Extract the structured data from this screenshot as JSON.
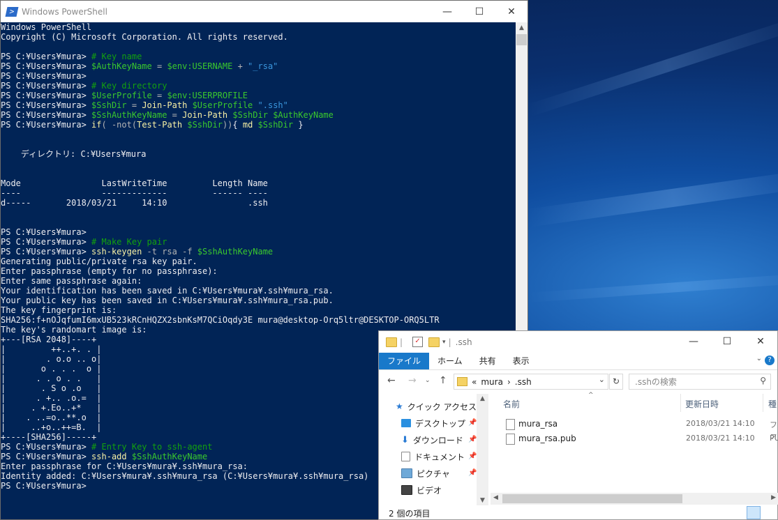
{
  "powershell": {
    "title": "Windows PowerShell",
    "lines": [
      [
        [
          "Windows PowerShell",
          "w"
        ]
      ],
      [
        [
          "Copyright (C) Microsoft Corporation. All rights reserved.",
          "w"
        ]
      ],
      [
        [
          "",
          "w"
        ]
      ],
      [
        [
          "PS C:¥Users¥mura> ",
          "w"
        ],
        [
          "# Key name",
          "cmt"
        ]
      ],
      [
        [
          "PS C:¥Users¥mura> ",
          "w"
        ],
        [
          "$AuthKeyName",
          "var"
        ],
        [
          " = ",
          "op"
        ],
        [
          "$env:USERNAME",
          "var"
        ],
        [
          " + ",
          "op"
        ],
        [
          "\"_rsa\"",
          "str"
        ]
      ],
      [
        [
          "PS C:¥Users¥mura>",
          "w"
        ]
      ],
      [
        [
          "PS C:¥Users¥mura> ",
          "w"
        ],
        [
          "# Key directory",
          "cmt"
        ]
      ],
      [
        [
          "PS C:¥Users¥mura> ",
          "w"
        ],
        [
          "$UserProfile",
          "var"
        ],
        [
          " = ",
          "op"
        ],
        [
          "$env:USERPROFILE",
          "var"
        ]
      ],
      [
        [
          "PS C:¥Users¥mura> ",
          "w"
        ],
        [
          "$SshDir",
          "var"
        ],
        [
          " = ",
          "op"
        ],
        [
          "Join-Path",
          "cmd"
        ],
        [
          " ",
          "w"
        ],
        [
          "$UserProfile",
          "var"
        ],
        [
          " ",
          "w"
        ],
        [
          "\".ssh\"",
          "str"
        ]
      ],
      [
        [
          "PS C:¥Users¥mura> ",
          "w"
        ],
        [
          "$SshAuthKeyName",
          "var"
        ],
        [
          " = ",
          "op"
        ],
        [
          "Join-Path",
          "cmd"
        ],
        [
          " ",
          "w"
        ],
        [
          "$SshDir",
          "var"
        ],
        [
          " ",
          "w"
        ],
        [
          "$AuthKeyName",
          "var"
        ]
      ],
      [
        [
          "PS C:¥Users¥mura> ",
          "w"
        ],
        [
          "if",
          "cmd"
        ],
        [
          "( ",
          "par"
        ],
        [
          "-not",
          "par"
        ],
        [
          "(",
          "par"
        ],
        [
          "Test-Path",
          "cmd"
        ],
        [
          " ",
          "w"
        ],
        [
          "$SshDir",
          "var"
        ],
        [
          "))",
          "par"
        ],
        [
          "{ ",
          "w"
        ],
        [
          "md",
          "cmd"
        ],
        [
          " ",
          "w"
        ],
        [
          "$SshDir",
          "var"
        ],
        [
          " }",
          "w"
        ]
      ],
      [
        [
          "",
          "w"
        ]
      ],
      [
        [
          "",
          "w"
        ]
      ],
      [
        [
          "    ディレクトリ: C:¥Users¥mura",
          "w"
        ]
      ],
      [
        [
          "",
          "w"
        ]
      ],
      [
        [
          "",
          "w"
        ]
      ],
      [
        [
          "Mode                LastWriteTime         Length Name",
          "w"
        ]
      ],
      [
        [
          "----                -------------         ------ ----",
          "w"
        ]
      ],
      [
        [
          "d-----       2018/03/21     14:10                .ssh",
          "w"
        ]
      ],
      [
        [
          "",
          "w"
        ]
      ],
      [
        [
          "",
          "w"
        ]
      ],
      [
        [
          "PS C:¥Users¥mura>",
          "w"
        ]
      ],
      [
        [
          "PS C:¥Users¥mura> ",
          "w"
        ],
        [
          "# Make Key pair",
          "cmt"
        ]
      ],
      [
        [
          "PS C:¥Users¥mura> ",
          "w"
        ],
        [
          "ssh-keygen",
          "cmd"
        ],
        [
          " -t rsa -f ",
          "par"
        ],
        [
          "$SshAuthKeyName",
          "var"
        ]
      ],
      [
        [
          "Generating public/private rsa key pair.",
          "w"
        ]
      ],
      [
        [
          "Enter passphrase (empty for no passphrase):",
          "w"
        ]
      ],
      [
        [
          "Enter same passphrase again:",
          "w"
        ]
      ],
      [
        [
          "Your identification has been saved in C:¥Users¥mura¥.ssh¥mura_rsa.",
          "w"
        ]
      ],
      [
        [
          "Your public key has been saved in C:¥Users¥mura¥.ssh¥mura_rsa.pub.",
          "w"
        ]
      ],
      [
        [
          "The key fingerprint is:",
          "w"
        ]
      ],
      [
        [
          "SHA256:f+nOJqfumI6mxUB523kRCnHQZX2sbnKsM7QCiOqdy3E mura@desktop-Orq5ltr@DESKTOP-ORQ5LTR",
          "w"
        ]
      ],
      [
        [
          "The key's randomart image is:",
          "w"
        ]
      ],
      [
        [
          "+---[RSA 2048]----+",
          "w"
        ]
      ],
      [
        [
          "|         ++..+. . |",
          "w"
        ]
      ],
      [
        [
          "|        . o.o .. o|",
          "w"
        ]
      ],
      [
        [
          "|       o . . .  o |",
          "w"
        ]
      ],
      [
        [
          "|      . . o . .   |",
          "w"
        ]
      ],
      [
        [
          "|       . S o .o   |",
          "w"
        ]
      ],
      [
        [
          "|      . +.. .o.=  |",
          "w"
        ]
      ],
      [
        [
          "|     . +.Eo..+*   |",
          "w"
        ]
      ],
      [
        [
          "|    . ..=o..**.o  |",
          "w"
        ]
      ],
      [
        [
          "|     ..+o..++=B.  |",
          "w"
        ]
      ],
      [
        [
          "+----[SHA256]-----+",
          "w"
        ]
      ],
      [
        [
          "PS C:¥Users¥mura> ",
          "w"
        ],
        [
          "# Entry Key to ssh-agent",
          "cmt"
        ]
      ],
      [
        [
          "PS C:¥Users¥mura> ",
          "w"
        ],
        [
          "ssh-add",
          "cmd"
        ],
        [
          " ",
          "w"
        ],
        [
          "$SshAuthKeyName",
          "var"
        ]
      ],
      [
        [
          "Enter passphrase for C:¥Users¥mura¥.ssh¥mura_rsa:",
          "w"
        ]
      ],
      [
        [
          "Identity added: C:¥Users¥mura¥.ssh¥mura_rsa (C:¥Users¥mura¥.ssh¥mura_rsa)",
          "w"
        ]
      ],
      [
        [
          "PS C:¥Users¥mura>",
          "w"
        ]
      ]
    ]
  },
  "explorer": {
    "title": ".ssh",
    "ribbon_tabs": [
      "ファイル",
      "ホーム",
      "共有",
      "表示"
    ],
    "address": {
      "prefix": "«",
      "path1": "mura",
      "sep": "›",
      "path2": ".ssh"
    },
    "search_placeholder": ".sshの検索",
    "nav_items": [
      {
        "label": "クイック アクセス",
        "icon": "star-icon"
      },
      {
        "label": "デスクトップ",
        "icon": "desktop-icon"
      },
      {
        "label": "ダウンロード",
        "icon": "download-icon"
      },
      {
        "label": "ドキュメント",
        "icon": "document-icon"
      },
      {
        "label": "ピクチャ",
        "icon": "picture-icon"
      },
      {
        "label": "ビデオ",
        "icon": "video-icon"
      }
    ],
    "columns": {
      "name": "名前",
      "date": "更新日時",
      "type": "種"
    },
    "files": [
      {
        "name": "mura_rsa",
        "date": "2018/03/21 14:10",
        "type": "ファ"
      },
      {
        "name": "mura_rsa.pub",
        "date": "2018/03/21 14:10",
        "type": "PU"
      }
    ],
    "status": "2 個の項目"
  },
  "colors": {
    "console_bg": "#012456",
    "comment": "#13a10e",
    "variable": "#3ac82d",
    "command": "#f9f1a5",
    "string": "#3a96dd",
    "ribbon_file": "#1979ca"
  }
}
